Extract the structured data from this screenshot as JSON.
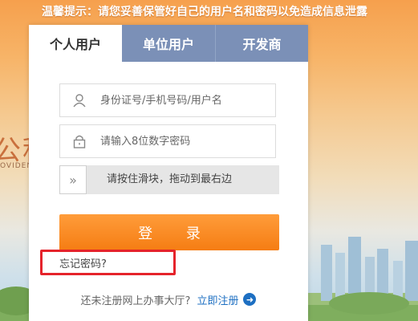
{
  "notice": "温馨提示：请您妥善保管好自己的用户名和密码以免造成信息泄露",
  "background": {
    "logo_text": "公积",
    "logo_sub": "OVIDEN"
  },
  "tabs": [
    {
      "label": "个人用户",
      "active": true
    },
    {
      "label": "单位用户",
      "active": false
    },
    {
      "label": "开发商",
      "active": false
    }
  ],
  "login": {
    "username_placeholder": "身份证号/手机号码/用户名",
    "password_placeholder": "请输入8位数字密码",
    "slider_text": "请按住滑块，拖动到最右边",
    "submit_label": "登 录",
    "forgot_label": "忘记密码?"
  },
  "footer": {
    "prompt": "还未注册网上办事大厅?",
    "register_label": "立即注册"
  },
  "colors": {
    "accent": "#f57d13",
    "tab_inactive": "#7b90b7",
    "link": "#1d6fc2",
    "highlight": "#e5232b"
  }
}
